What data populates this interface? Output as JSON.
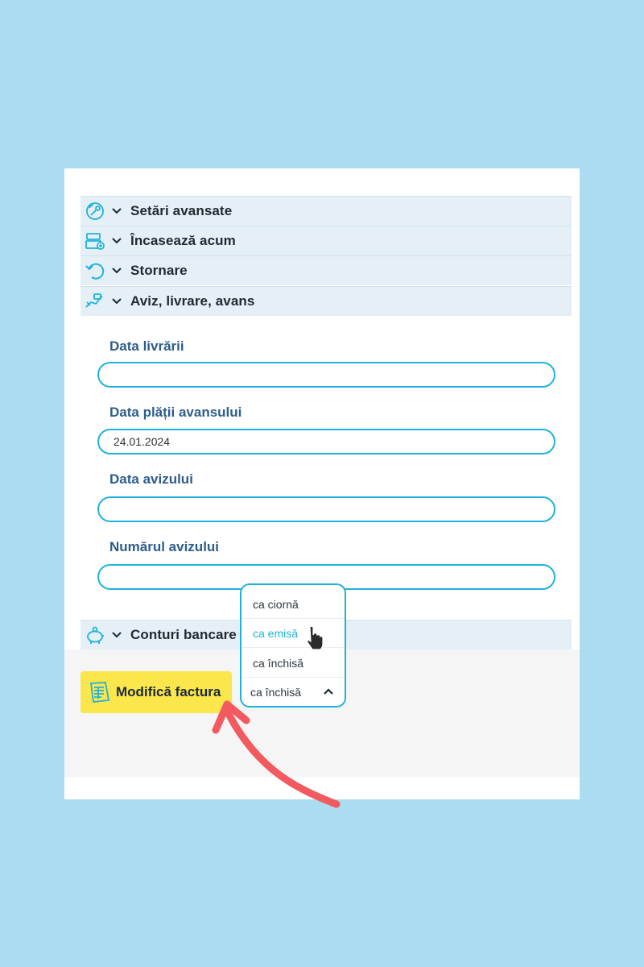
{
  "sections": [
    {
      "label": "Setări avansate",
      "icon": "wrench-gear-icon"
    },
    {
      "label": "Încasează acum",
      "icon": "cash-register-icon"
    },
    {
      "label": "Stornare",
      "icon": "undo-arrow-icon"
    },
    {
      "label": "Aviz, livrare, avans",
      "icon": "truck-hand-icon"
    },
    {
      "label": "Conturi bancare",
      "icon": "piggy-bank-icon"
    }
  ],
  "fields": [
    {
      "label": "Data livrării",
      "value": ""
    },
    {
      "label": "Data plății avansului",
      "value": "24.01.2024"
    },
    {
      "label": "Data avizului",
      "value": ""
    },
    {
      "label": "Numărul avizului",
      "value": ""
    }
  ],
  "button": {
    "label": "Modifică factura",
    "icon": "invoice-icon"
  },
  "dropdown": {
    "options": [
      "ca ciornă",
      "ca emisă",
      "ca închisă"
    ],
    "active_option": "ca emisă",
    "selected": "ca închisă",
    "caret": "⌃"
  },
  "colors": {
    "background": "#acdcf2",
    "accent": "#1fb2dc",
    "section_row": "#e4eff6",
    "label": "#2d5d8c",
    "button": "#fbe64b",
    "annotation_arrow": "#f25a5f"
  }
}
